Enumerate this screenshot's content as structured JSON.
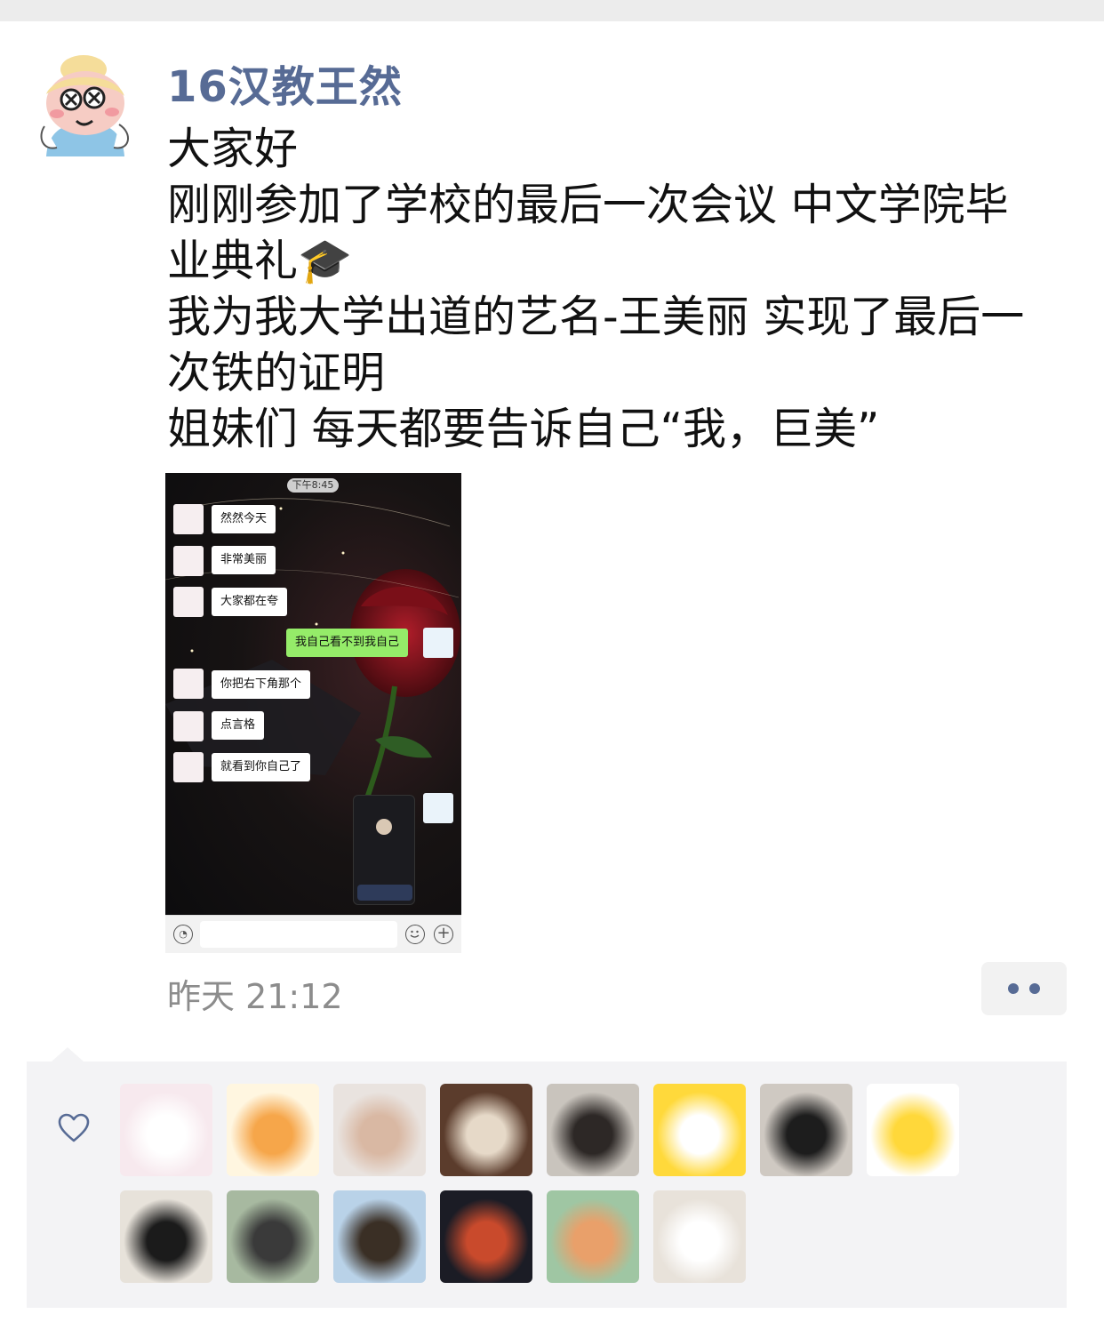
{
  "post": {
    "author": "16汉教王然",
    "lines": [
      "大家好",
      "刚刚参加了学校的最后一次会议 中文学院毕",
      "业典礼🎓",
      "我为我大学出道的艺名-王美丽 实现了最后一",
      "次铁的证明",
      "姐妹们 每天都要告诉自己“我，巨美”"
    ],
    "timestamp": "昨天 21:12"
  },
  "screenshot": {
    "status_time": "下午8:45",
    "messages": [
      {
        "text": "然然今天",
        "from": "other"
      },
      {
        "text": "非常美丽",
        "from": "other"
      },
      {
        "text": "大家都在夸",
        "from": "other"
      },
      {
        "text": "我自己看不到我自己",
        "from": "me"
      },
      {
        "text": "你把右下角那个",
        "from": "other"
      },
      {
        "text": "点言格",
        "from": "other"
      },
      {
        "text": "就看到你自己了",
        "from": "other"
      }
    ]
  },
  "likes": {
    "icon": "heart-outline-icon",
    "accent": "#576b95",
    "avatars": [
      {
        "name": "white-puppy",
        "colors": [
          "#f7e9ee",
          "#ffffff"
        ]
      },
      {
        "name": "watermelon-cartoon",
        "colors": [
          "#fff6e0",
          "#f6a64a"
        ]
      },
      {
        "name": "girl-surprised",
        "colors": [
          "#e9e3df",
          "#d9b8a3"
        ]
      },
      {
        "name": "person-with-cat",
        "colors": [
          "#5b3c2c",
          "#e6d9c8"
        ]
      },
      {
        "name": "man-portrait",
        "colors": [
          "#c9c4bd",
          "#2d2826"
        ]
      },
      {
        "name": "duck-cartoon",
        "colors": [
          "#ffd93b",
          "#ffffff"
        ]
      },
      {
        "name": "boy-sunglasses",
        "colors": [
          "#cfc9c2",
          "#1d1d1d"
        ]
      },
      {
        "name": "pikachu-pair",
        "colors": [
          "#ffffff",
          "#ffd83a"
        ]
      },
      {
        "name": "black-bag",
        "colors": [
          "#e7e2da",
          "#1b1b1b"
        ]
      },
      {
        "name": "girl-mask",
        "colors": [
          "#a7b9a0",
          "#3a3a3a"
        ]
      },
      {
        "name": "bench-lake",
        "colors": [
          "#b9d2e8",
          "#3a2f25"
        ]
      },
      {
        "name": "boy-red-jacket",
        "colors": [
          "#1b1c25",
          "#c94a2c"
        ]
      },
      {
        "name": "deer-painting",
        "colors": [
          "#9fc6a3",
          "#e9a06a"
        ]
      },
      {
        "name": "moomin-cartoon",
        "colors": [
          "#e8e2da",
          "#ffffff"
        ]
      }
    ]
  }
}
